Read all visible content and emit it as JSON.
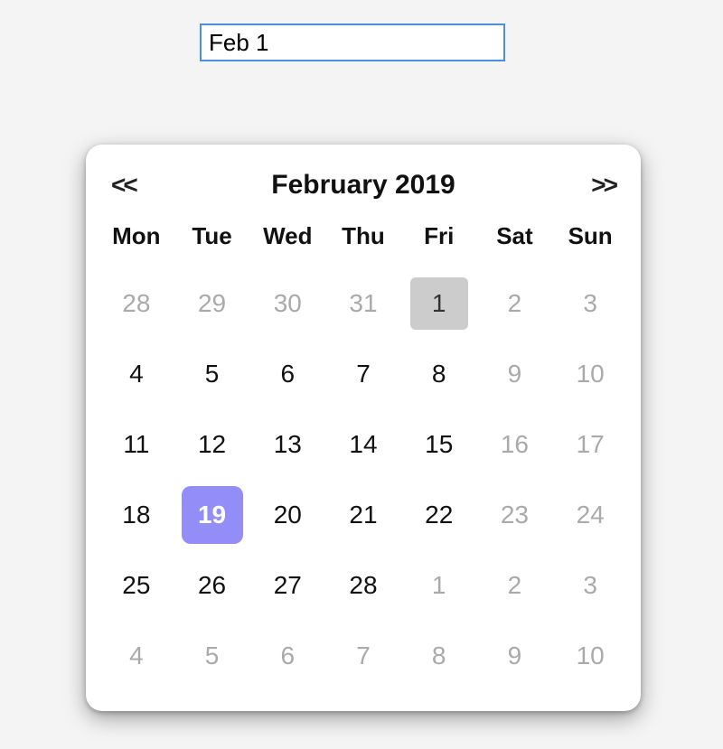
{
  "input": {
    "value": "Feb 1"
  },
  "calendar": {
    "prev_label": "<<",
    "next_label": ">>",
    "title": "February 2019",
    "weekdays": [
      "Mon",
      "Tue",
      "Wed",
      "Thu",
      "Fri",
      "Sat",
      "Sun"
    ],
    "days": [
      {
        "n": "28",
        "muted": true
      },
      {
        "n": "29",
        "muted": true
      },
      {
        "n": "30",
        "muted": true
      },
      {
        "n": "31",
        "muted": true
      },
      {
        "n": "1",
        "selected": true
      },
      {
        "n": "2",
        "muted": true
      },
      {
        "n": "3",
        "muted": true
      },
      {
        "n": "4"
      },
      {
        "n": "5"
      },
      {
        "n": "6"
      },
      {
        "n": "7"
      },
      {
        "n": "8"
      },
      {
        "n": "9",
        "muted": true
      },
      {
        "n": "10",
        "muted": true
      },
      {
        "n": "11"
      },
      {
        "n": "12"
      },
      {
        "n": "13"
      },
      {
        "n": "14"
      },
      {
        "n": "15"
      },
      {
        "n": "16",
        "muted": true
      },
      {
        "n": "17",
        "muted": true
      },
      {
        "n": "18"
      },
      {
        "n": "19",
        "today": true
      },
      {
        "n": "20"
      },
      {
        "n": "21"
      },
      {
        "n": "22"
      },
      {
        "n": "23",
        "muted": true
      },
      {
        "n": "24",
        "muted": true
      },
      {
        "n": "25"
      },
      {
        "n": "26"
      },
      {
        "n": "27"
      },
      {
        "n": "28"
      },
      {
        "n": "1",
        "muted": true
      },
      {
        "n": "2",
        "muted": true
      },
      {
        "n": "3",
        "muted": true
      },
      {
        "n": "4",
        "muted": true
      },
      {
        "n": "5",
        "muted": true
      },
      {
        "n": "6",
        "muted": true
      },
      {
        "n": "7",
        "muted": true
      },
      {
        "n": "8",
        "muted": true
      },
      {
        "n": "9",
        "muted": true
      },
      {
        "n": "10",
        "muted": true
      }
    ]
  }
}
